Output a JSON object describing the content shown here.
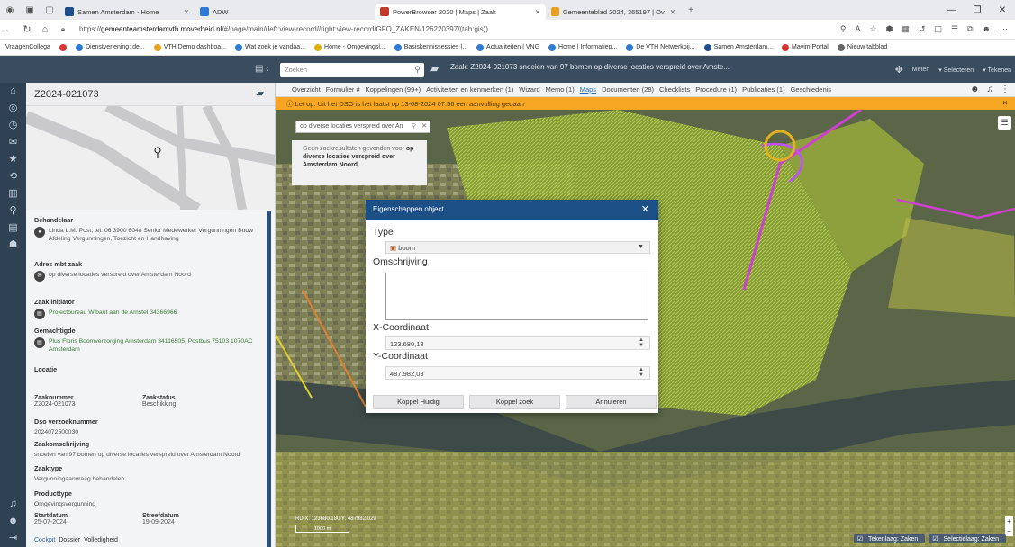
{
  "browser": {
    "tabs": [
      {
        "label": "Samen Amsterdam - Home",
        "color": "#1e4e8c"
      },
      {
        "label": "ADW",
        "color": "#2d7bd4"
      },
      {
        "label": "PowerBrowser 2020 | Maps | Zaak",
        "color": "#c23a2a"
      },
      {
        "label": "Gemeenteblad 2024, 365197 | Ov",
        "color": "#e8a020"
      }
    ],
    "url_prefix": "https://",
    "url_host": "gemeenteamsterdamvth.moverheid.nl",
    "url_path": "/#/page/main/(left:view-record//right:view-record/GFO_ZAKEN/126220397/(tab:gis))",
    "bookmarks": [
      "VraagenCollega",
      "Dienstverlening: de...",
      "VTH Demo dashboa...",
      "Wat zoek je vandaa...",
      "Home - Omgevingsl...",
      "Basiskennissessies |...",
      "Actualiteiten | VNG",
      "Home | Informatiep...",
      "De VTH Netwerkbij...",
      "Samen Amsterdam...",
      "Mavim Portal",
      "Nieuw tabblad"
    ]
  },
  "header": {
    "search_placeholder": "Zoeken",
    "zaak_title": "Zaak: Z2024-021073 snoeien van 97 bomen op diverse locaties verspreid over Amste...",
    "tools": [
      "Meten",
      "Selecteren",
      "Tekenen"
    ]
  },
  "leftpanel": {
    "zaak_id": "Z2024-021073",
    "behandelaar_label": "Behandelaar",
    "behandelaar_value": "Linda L.M. Post, tel: 06 3900 6048 Senior Medewerker Vergunningen Bouw Afdeling Vergunningen, Toezicht en Handhaving",
    "adres_label": "Adres mbt zaak",
    "adres_value": "op diverse locaties verspreid over Amsterdam Noord",
    "initiator_label": "Zaak initiator",
    "initiator_value": "Projectbureau Wibaut aan de Amstel 34366966",
    "gemachtigde_label": "Gemachtigde",
    "gemachtigde_value": "Plus Floris Boomverzorging Amsterdam 34116505, Postbus 75103 1070AC Amsterdam",
    "locatie_label": "Locatie",
    "zaaknummer_label": "Zaaknummer",
    "zaaknummer_value": "Z2024-021073",
    "zaakstatus_label": "Zaakstatus",
    "zaakstatus_value": "Beschikking",
    "dso_label": "Dso verzoeknummer",
    "dso_value": "2024072500030",
    "omschrijving_label": "Zaakomschrijving",
    "omschrijving_value": "snoeien van 97 bomen op diverse locaties verspreid over Amsterdam Noord",
    "zaaktype_label": "Zaaktype",
    "zaaktype_value": "Vergunningaanvraag behandelen",
    "producttype_label": "Producttype",
    "producttype_value": "Omgevingsvergunning",
    "startdatum_label": "Startdatum",
    "startdatum_value": "25-07-2024",
    "streefdatum_label": "Streefdatum",
    "streefdatum_value": "19-09-2024",
    "footer_links": [
      "Cockpit",
      "Dossier",
      "Volledigheid"
    ]
  },
  "main_tabs": [
    "Overzicht",
    "Formulier #",
    "Koppelingen (99+)",
    "Activiteiten en kenmerken (1)",
    "Wizard",
    "Memo (1)",
    "Maps",
    "Documenten (28)",
    "Checklists",
    "Procedure (1)",
    "Publicaties (1)",
    "Geschiedenis"
  ],
  "warning": "Let op: Uit het DSO is het laatst op 13-08-2024 07:56 een aanvulling gedaan",
  "map": {
    "search_value": "op diverse locaties verspreid over An",
    "noresult_prefix": "Geen zoekresultaten gevonden voor",
    "noresult_term": "op diverse locaties verspreid over Amsterdam Noord",
    "coord_readout": "RD X: 123680.180 Y: 487982.029",
    "scale": "1000 m",
    "layers": [
      "Tekenlaag: Zaken",
      "Selectielaag: Zaken"
    ]
  },
  "modal": {
    "title": "Eigenschappen object",
    "type_label": "Type",
    "type_value": "boom",
    "omschrijving_label": "Omschrijving",
    "x_label": "X-Coordinaat",
    "x_value": "123.680,18",
    "y_label": "Y-Coordinaat",
    "y_value": "487.982,03",
    "btn_koppel_huidig": "Koppel Huidig",
    "btn_koppel_zoek": "Koppel zoek",
    "btn_annuleren": "Annuleren"
  }
}
